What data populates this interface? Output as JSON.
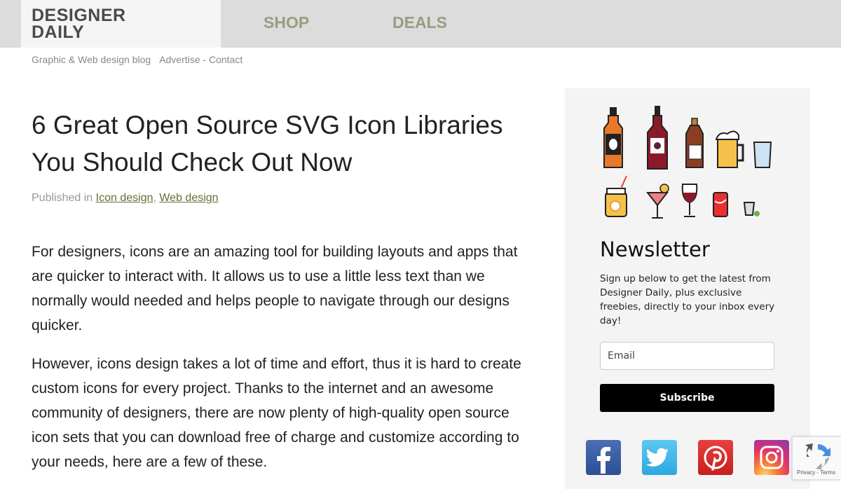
{
  "header": {
    "logo_line1": "DESIGNER",
    "logo_line2": "DAILY",
    "nav": [
      "SHOP",
      "DEALS"
    ]
  },
  "tagline": {
    "text": "Graphic & Web design blog",
    "links": "Advertise - Contact"
  },
  "article": {
    "title": "6 Great Open Source SVG Icon Libraries You Should Check Out Now",
    "published_prefix": "Published in ",
    "categories": [
      "Icon design",
      "Web design"
    ],
    "separator": ", ",
    "paragraphs": [
      "For designers, icons are an amazing tool for building layouts and apps that are quicker to interact with. It allows us to use a little less text than we normally would needed and helps people to navigate through our designs quicker.",
      "However, icons design takes a lot of time and effort, thus it is hard to create custom icons for every project. Thanks to the internet and an awesome community of designers, there are now plenty of high-quality open source icon sets that you can download free of charge and customize according to your needs, here are a few of these."
    ]
  },
  "sidebar": {
    "newsletter_title": "Newsletter",
    "newsletter_desc": "Sign up below to get the latest from Designer Daily, plus exclusive freebies, directly to your inbox every day!",
    "email_placeholder": "Email",
    "subscribe_label": "Subscribe",
    "social": [
      "facebook-icon",
      "twitter-icon",
      "pinterest-icon",
      "instagram-icon"
    ]
  },
  "recaptcha": {
    "text": "Privacy - Terms"
  }
}
